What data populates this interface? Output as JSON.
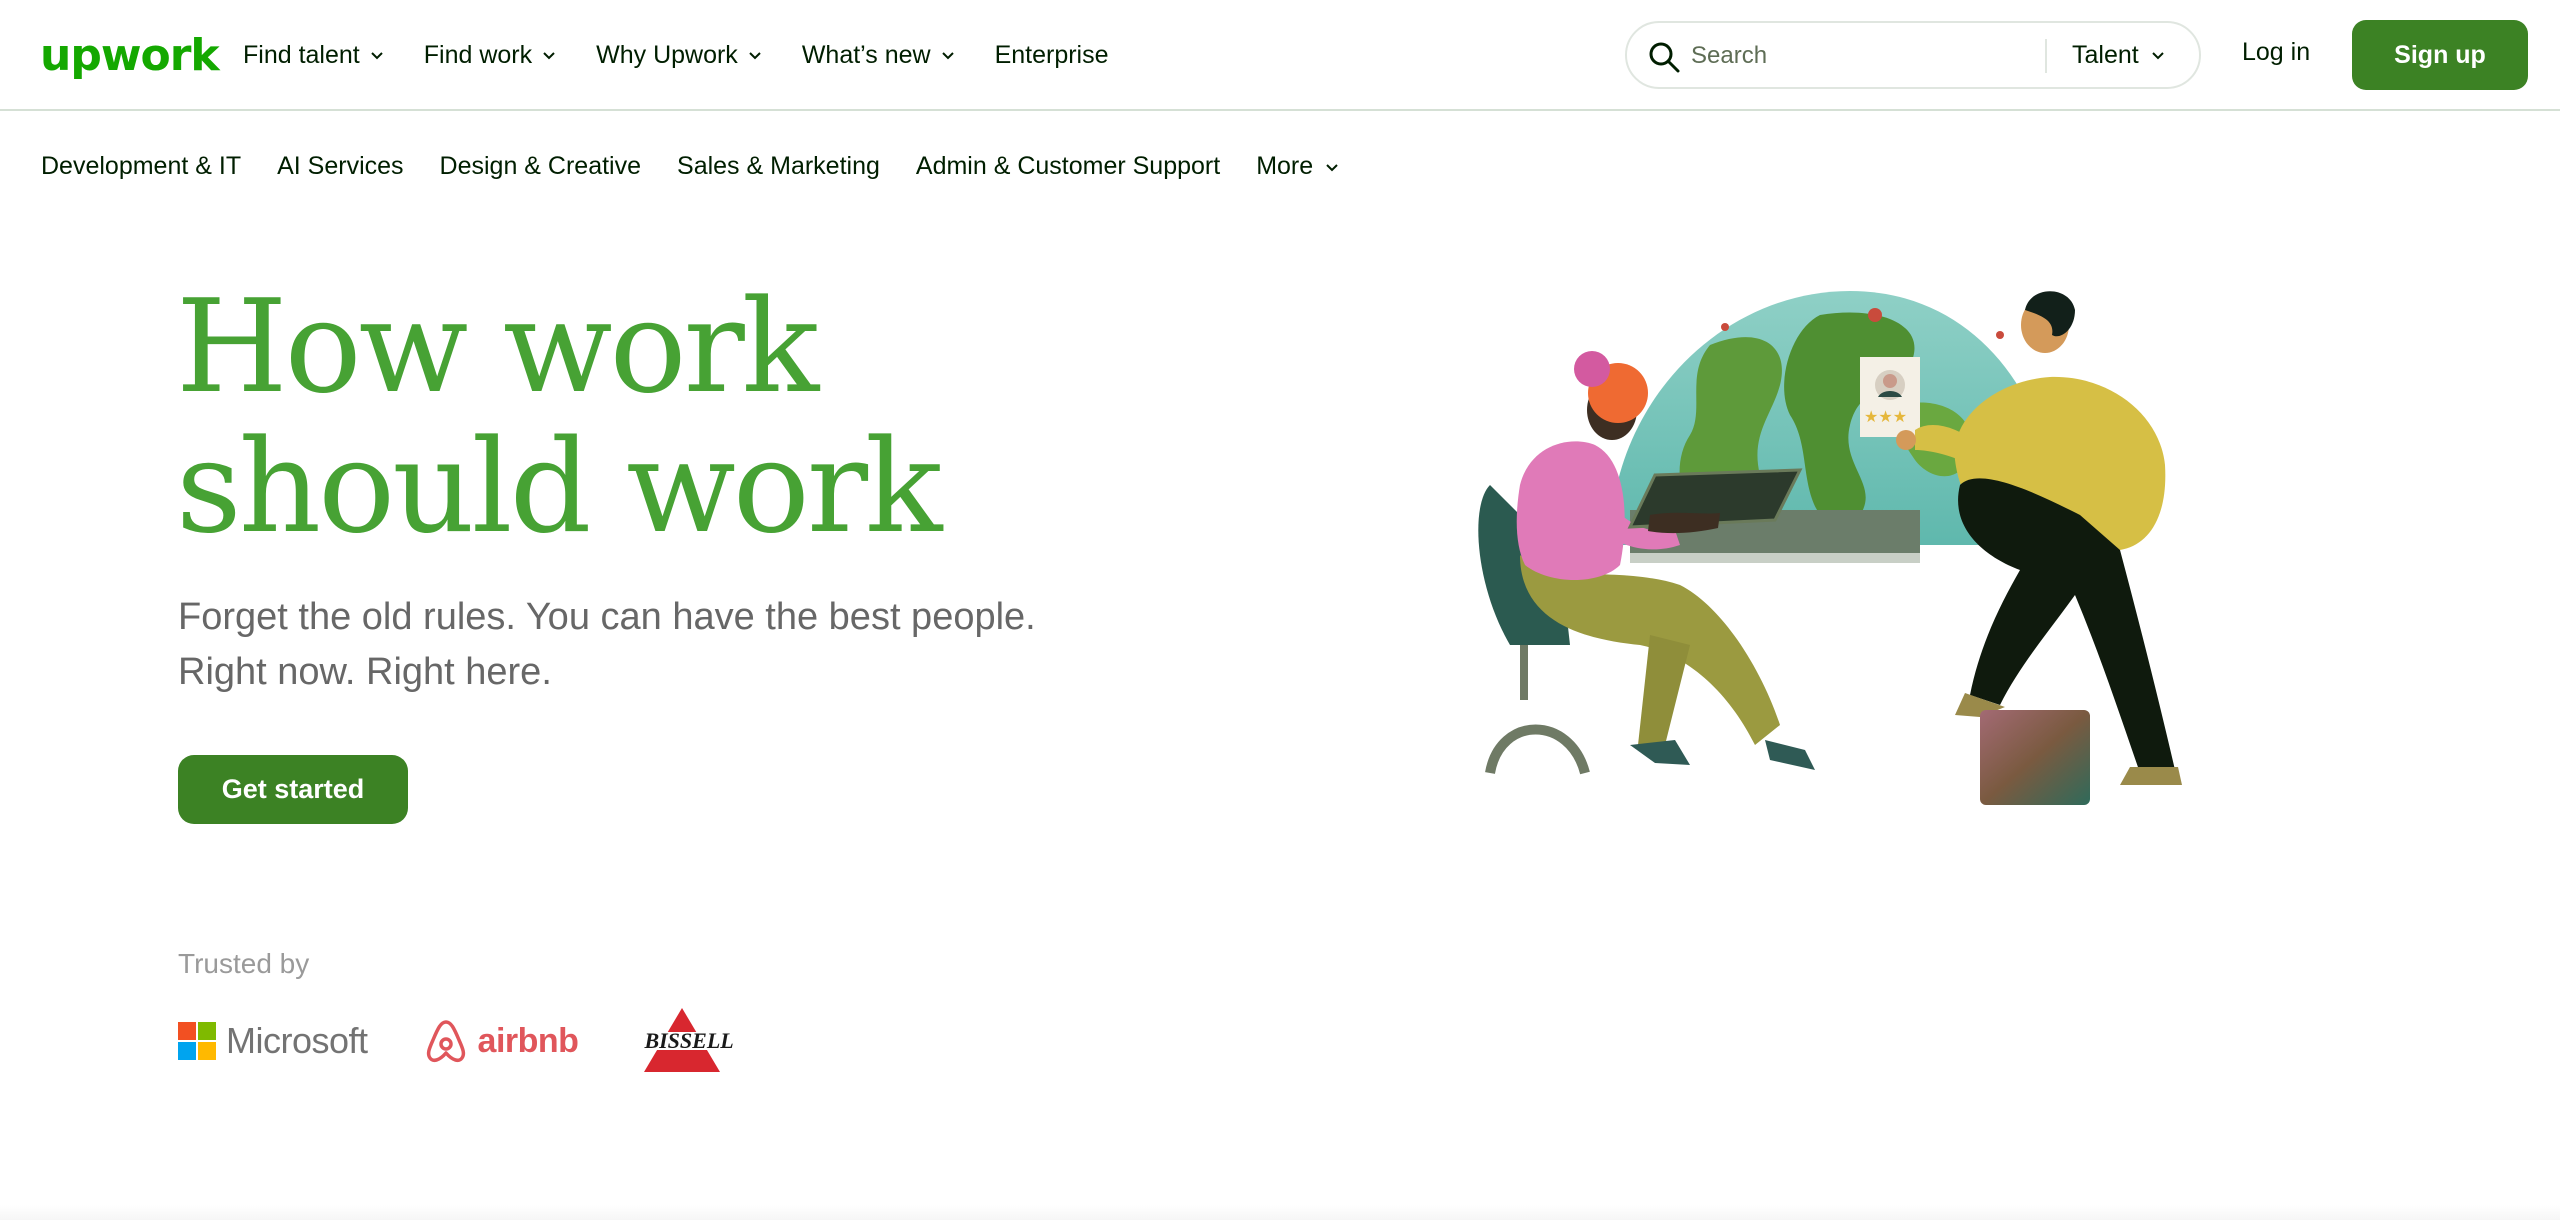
{
  "header": {
    "logo_text": "upwork",
    "nav": [
      {
        "label": "Find talent",
        "has_dropdown": true
      },
      {
        "label": "Find work",
        "has_dropdown": true
      },
      {
        "label": "Why Upwork",
        "has_dropdown": true
      },
      {
        "label": "What’s new",
        "has_dropdown": true
      },
      {
        "label": "Enterprise",
        "has_dropdown": false
      }
    ],
    "search": {
      "placeholder": "Search",
      "scope": "Talent"
    },
    "login_label": "Log in",
    "signup_label": "Sign up"
  },
  "categories": {
    "items": [
      "Development & IT",
      "AI Services",
      "Design & Creative",
      "Sales & Marketing",
      "Admin & Customer Support"
    ],
    "more_label": "More"
  },
  "hero": {
    "title_line1": "How work",
    "title_line2": "should work",
    "subtitle_line1": "Forget the old rules. You can have the best people.",
    "subtitle_line2": "Right now. Right here.",
    "cta_label": "Get started"
  },
  "trusted": {
    "label": "Trusted by",
    "brands": [
      "Microsoft",
      "airbnb",
      "BISSELL"
    ]
  },
  "colors": {
    "brand_green": "#14a800",
    "title_green": "#47a234",
    "button_green": "#3c8224",
    "text_dark": "#001e00",
    "subtitle_gray": "#676767"
  },
  "icons": {
    "search": "search-icon",
    "dropdown": "chevron-down-icon"
  }
}
